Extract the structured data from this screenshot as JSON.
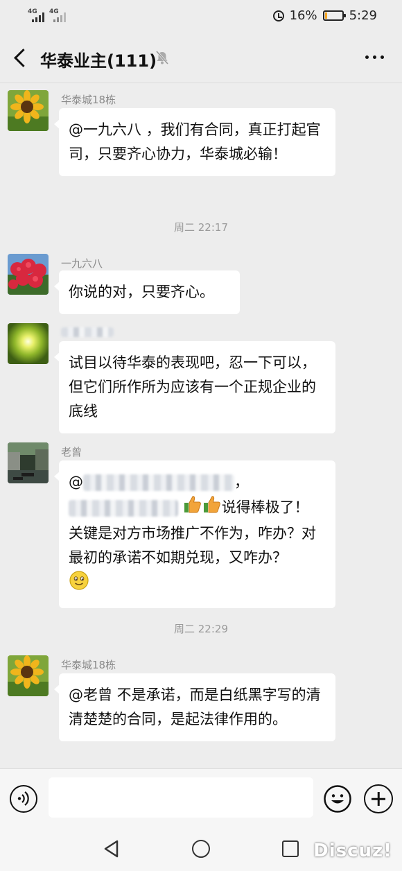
{
  "status_bar": {
    "signal_1": "4G",
    "signal_2": "4G",
    "battery_percent": "16%",
    "battery_level": 0.16,
    "time": "5:29",
    "alarm_icon": "alarm-clock-icon"
  },
  "header": {
    "title": "华泰业主(111)",
    "mute_icon": "bell-muted-icon",
    "back_icon": "chevron-left-icon",
    "more_icon": "more-horizontal-icon"
  },
  "messages": [
    {
      "sender": "华泰城18栋",
      "text": "@一九六八 ，我们有合同，真正打起官司，只要齐心协力，华泰城必输！"
    },
    {
      "sender": "一九六八",
      "text": "你说的对，只要齐心。"
    },
    {
      "sender": "",
      "text": "试目以待华泰的表现吧，忍一下可以，但它们所作所为应该有一个正规企业的底线"
    },
    {
      "sender": "老曾",
      "prefix": "@",
      "comma": "，",
      "mid": "说得棒极了！",
      "text": "关键是对方市场推广不作为，咋办？对最初的承诺不如期兑现，又咋办？"
    },
    {
      "sender": "华泰城18栋",
      "text": "@老曾  不是承诺，而是白纸黑字写的清清楚楚的合同，是起法律作用的。"
    }
  ],
  "timestamps": [
    "周二 22:17",
    "周二 22:29"
  ],
  "input_bar": {
    "voice_icon": "voice-icon",
    "emoji_icon": "emoji-icon",
    "plus_icon": "plus-circle-icon"
  },
  "nav_bar": {
    "back_icon": "triangle-back-icon",
    "home_icon": "circle-home-icon",
    "recent_icon": "square-recent-icon"
  },
  "watermark": "Discuz!"
}
